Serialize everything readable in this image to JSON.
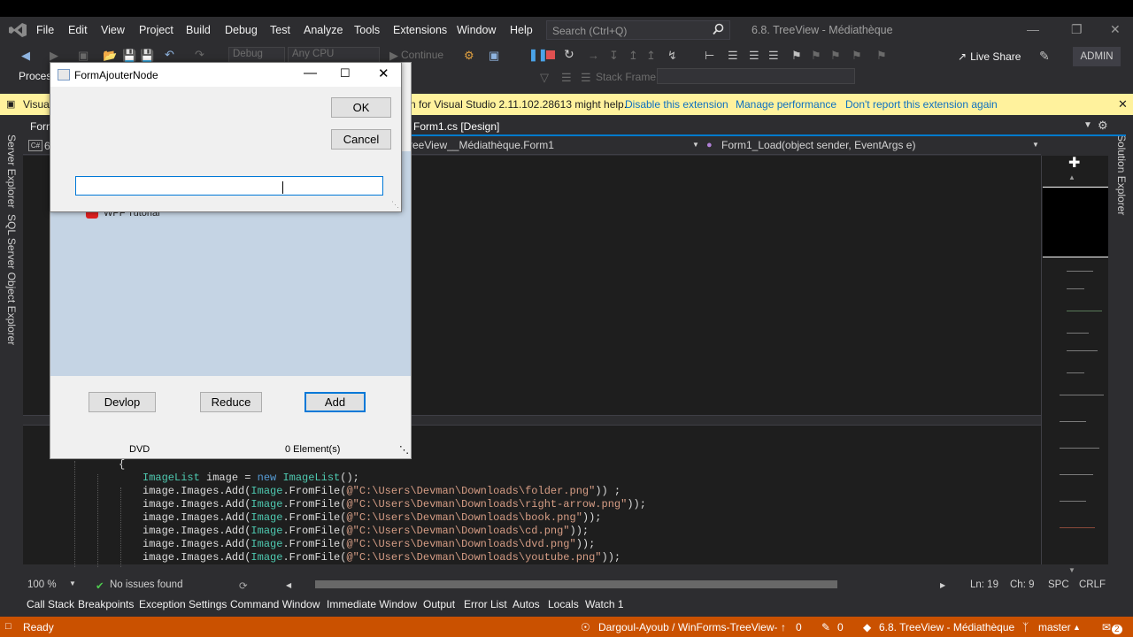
{
  "menu": {
    "items": [
      "File",
      "Edit",
      "View",
      "Project",
      "Build",
      "Debug",
      "Test",
      "Analyze",
      "Tools",
      "Extensions",
      "Window",
      "Help"
    ],
    "search_placeholder": "Search (Ctrl+Q)",
    "solution_title": "6.8. TreeView - Médiathèque"
  },
  "toolbar": {
    "config": "Debug",
    "platform": "Any CPU",
    "continue_label": "Continue",
    "stack_frame_label": "Stack Frame:",
    "process_label": "Proces",
    "live_share": "Live Share",
    "user": "ADMIN"
  },
  "infobar": {
    "prefix": "Visual",
    "message": "n for Visual Studio 2.11.102.28613 might help.",
    "link_disable": "Disable this extension",
    "link_manage": "Manage performance",
    "link_dont_report": "Don't report this extension again"
  },
  "side": {
    "server_explorer": "Server Explorer",
    "sql_explorer": "SQL Server Object Explorer",
    "solution_explorer": "Solution Explorer"
  },
  "editor": {
    "left_tab_fragment": "Form",
    "left_tab_icon_fragment": "6",
    "active_tab": "Form1.cs [Design]",
    "nav_class": "reeView__Médiathèque.Form1",
    "nav_member": "Form1_Load(object sender, EventArgs e)",
    "code": {
      "brace": "{",
      "l1_type": "ImageList",
      "l1_mid": " image = ",
      "l1_new": "new",
      "l1_end": "();",
      "add_prefix": "image.Images.Add(",
      "image_type": "Image",
      "from_file": ".FromFile(",
      "paths": [
        "@\"C:\\Users\\Devman\\Downloads\\folder.png\"",
        "@\"C:\\Users\\Devman\\Downloads\\right-arrow.png\"",
        "@\"C:\\Users\\Devman\\Downloads\\book.png\"",
        "@\"C:\\Users\\Devman\\Downloads\\cd.png\"",
        "@\"C:\\Users\\Devman\\Downloads\\dvd.png\"",
        "@\"C:\\Users\\Devman\\Downloads\\youtube.png\""
      ],
      "endings": [
        ")) ;",
        "));",
        "));",
        "));",
        "));",
        "));"
      ]
    }
  },
  "edit_status": {
    "zoom": "100 %",
    "issues": "No issues found",
    "line": "Ln: 19",
    "col": "Ch: 9",
    "spc": "SPC",
    "crlf": "CRLF"
  },
  "tool_tabs": [
    "Call Stack",
    "Breakpoints",
    "Exception Settings",
    "Command Window",
    "Immediate Window",
    "Output",
    "Error List",
    "Autos",
    "Locals",
    "Watch 1"
  ],
  "status_bar": {
    "state": "Ready",
    "repo": "Dargoul-Ayoub / WinForms-TreeView-",
    "push_count": "0",
    "changes_count": "0",
    "solution": "6.8. TreeView - Médiathèque",
    "branch": "master",
    "notifications": "2"
  },
  "form1": {
    "tree_item": "WPF Tutorial",
    "buttons": {
      "develop": "Devlop",
      "reduce": "Reduce",
      "add": "Add"
    },
    "status_left": "DVD",
    "status_right": "0 Element(s)"
  },
  "dialog": {
    "title": "FormAjouterNode",
    "ok": "OK",
    "cancel": "Cancel",
    "input_value": ""
  },
  "colors": {
    "accent": "#007acc",
    "status_bar": "#ca5100",
    "infobar": "#fff29d",
    "tree_bg": "#c5d4e4"
  }
}
